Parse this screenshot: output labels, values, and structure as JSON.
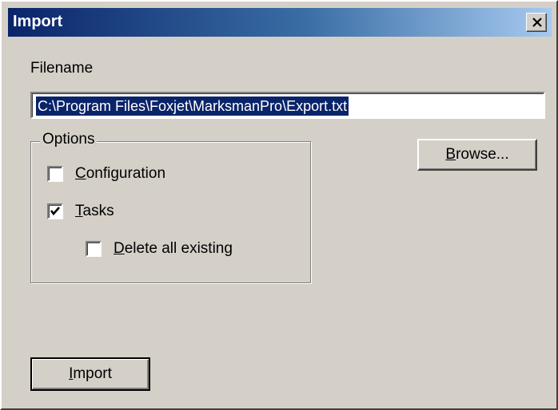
{
  "window": {
    "title": "Import",
    "close_icon": "close-icon"
  },
  "filename": {
    "label": "Filename",
    "value": "C:\\Program Files\\Foxjet\\MarksmanPro\\Export.txt"
  },
  "options": {
    "legend": "Options",
    "configuration": {
      "mnemonic": "C",
      "rest": "onfiguration",
      "checked": false
    },
    "tasks": {
      "mnemonic": "T",
      "rest": "asks",
      "checked": true
    },
    "delete_all": {
      "mnemonic": "D",
      "rest": "elete all existing",
      "checked": false
    }
  },
  "buttons": {
    "browse": {
      "mnemonic": "B",
      "rest": "rowse..."
    },
    "import": {
      "mnemonic": "I",
      "rest": "mport"
    }
  },
  "colors": {
    "title_gradient_start": "#0a246a",
    "title_gradient_end": "#a6caf0",
    "face": "#d4d0c8",
    "selection": "#0a246a"
  }
}
